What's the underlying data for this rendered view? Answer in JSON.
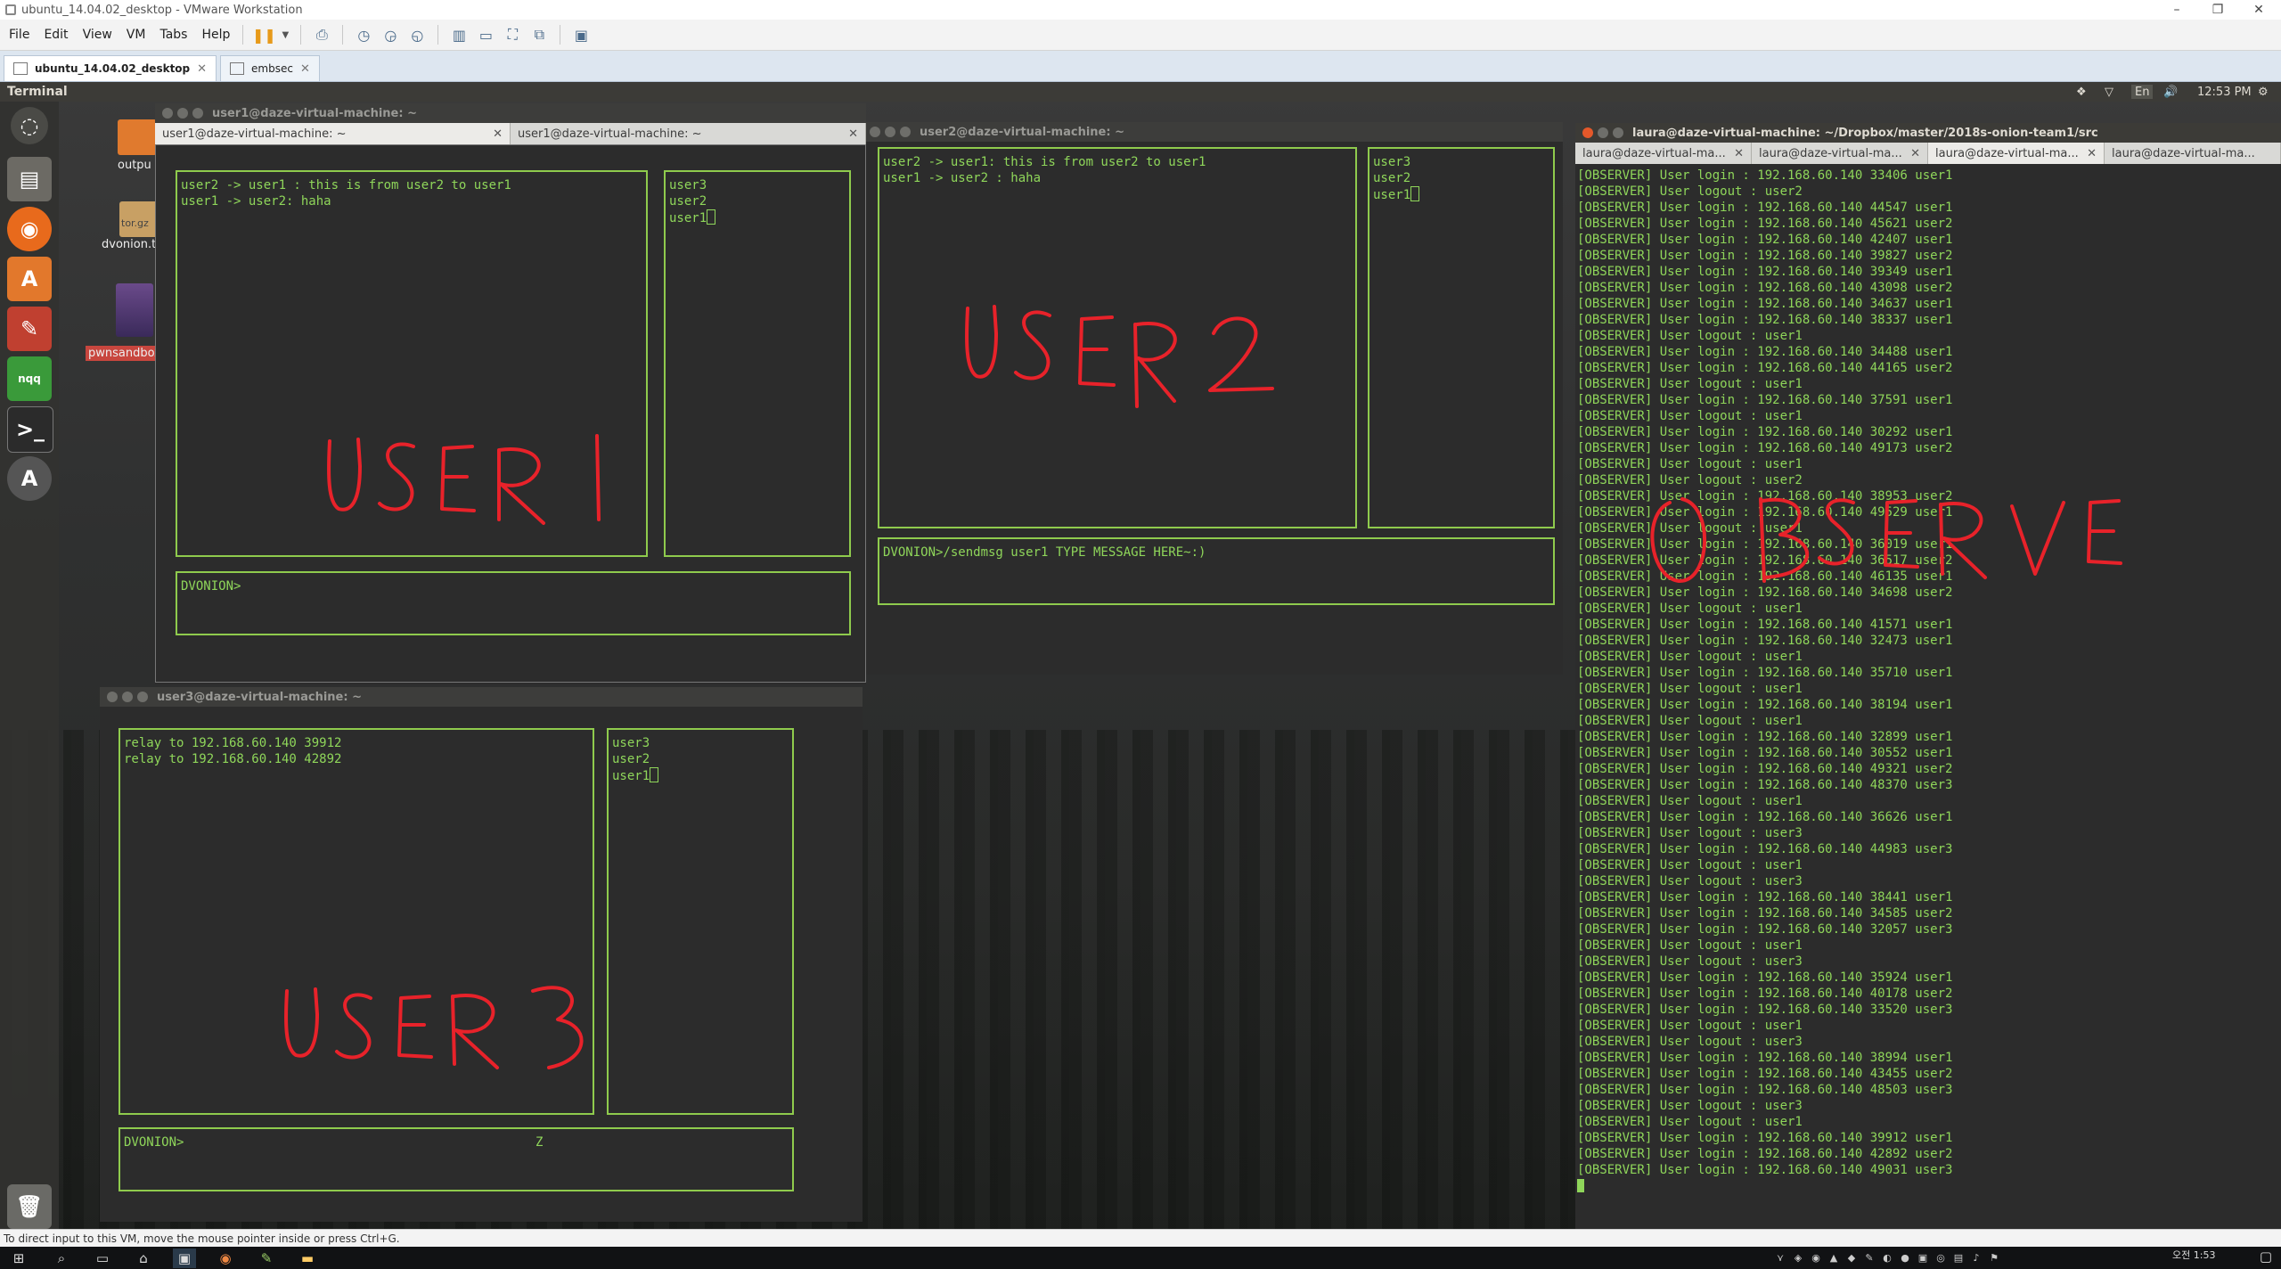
{
  "app": {
    "window_title": "ubuntu_14.04.02_desktop - VMware Workstation",
    "menu": [
      "File",
      "Edit",
      "View",
      "VM",
      "Tabs",
      "Help"
    ],
    "tabs": [
      {
        "label": "ubuntu_14.04.02_desktop",
        "active": true
      },
      {
        "label": "embsec",
        "active": false
      }
    ],
    "status_text": "To direct input to this VM, move the mouse pointer inside or press Ctrl+G."
  },
  "guest": {
    "topbar_title": "Terminal",
    "clock": "12:53 PM",
    "keyboard_layout": "En",
    "desktop_icons": [
      {
        "label": "outpu",
        "color": "#e07a2e"
      },
      {
        "label": "tor.gz",
        "color": "#c8a064"
      },
      {
        "label": "dvonion.tgz",
        "color": ""
      },
      {
        "label": "pwnsandbox.ova",
        "color": "#c8463e"
      }
    ],
    "launcher_icons": [
      "dash-icon",
      "files-icon",
      "firefox-icon",
      "software-center-icon",
      "settings-icon",
      "nqq-icon",
      "terminal-icon",
      "updater-icon",
      "trash-icon"
    ]
  },
  "win_user1": {
    "title": "user1@daze-virtual-machine: ~",
    "tabs": [
      "user1@daze-virtual-machine: ~",
      "user1@daze-virtual-machine: ~"
    ],
    "messages": [
      "user2 -> user1 : this is from user2 to user1",
      "user1 -> user2: haha"
    ],
    "users": [
      "user3",
      "user2",
      "user1"
    ],
    "prompt": "DVONION>",
    "annotation": "USER1"
  },
  "win_user2": {
    "title": "user2@daze-virtual-machine: ~",
    "messages": [
      "user2 -> user1: this is from user2 to user1",
      "user1 -> user2 : haha"
    ],
    "users": [
      "user3",
      "user2",
      "user1"
    ],
    "prompt": "DVONION>/sendmsg user1 TYPE MESSAGE HERE~:)",
    "annotation": "USER2"
  },
  "win_user3": {
    "title": "user3@daze-virtual-machine: ~",
    "messages": [
      "relay to 192.168.60.140 39912",
      "relay to 192.168.60.140 42892"
    ],
    "users": [
      "user3",
      "user2",
      "user1"
    ],
    "prompt": "DVONION>",
    "prompt_extra": "Z",
    "annotation": "USER3"
  },
  "win_observer": {
    "title": "laura@daze-virtual-machine: ~/Dropbox/master/2018s-onion-team1/src",
    "tabs": [
      "laura@daze-virtual-ma...",
      "laura@daze-virtual-ma...",
      "laura@daze-virtual-ma...",
      "laura@daze-virtual-ma..."
    ],
    "annotation": "OBSERVE",
    "lines": [
      "[OBSERVER] User login : 192.168.60.140 33406 user1",
      "[OBSERVER] User logout : user2",
      "[OBSERVER] User login : 192.168.60.140 44547 user1",
      "[OBSERVER] User login : 192.168.60.140 45621 user2",
      "[OBSERVER] User login : 192.168.60.140 42407 user1",
      "[OBSERVER] User login : 192.168.60.140 39827 user2",
      "[OBSERVER] User login : 192.168.60.140 39349 user1",
      "[OBSERVER] User login : 192.168.60.140 43098 user2",
      "[OBSERVER] User login : 192.168.60.140 34637 user1",
      "[OBSERVER] User login : 192.168.60.140 38337 user1",
      "[OBSERVER] User logout : user1",
      "[OBSERVER] User login : 192.168.60.140 34488 user1",
      "[OBSERVER] User login : 192.168.60.140 44165 user2",
      "[OBSERVER] User logout : user1",
      "[OBSERVER] User login : 192.168.60.140 37591 user1",
      "[OBSERVER] User logout : user1",
      "[OBSERVER] User login : 192.168.60.140 30292 user1",
      "[OBSERVER] User login : 192.168.60.140 49173 user2",
      "[OBSERVER] User logout : user1",
      "[OBSERVER] User logout : user2",
      "[OBSERVER] User login : 192.168.60.140 38953 user2",
      "[OBSERVER] User login : 192.168.60.140 49529 user1",
      "[OBSERVER] User logout : user1",
      "[OBSERVER] User login : 192.168.60.140 36019 user1",
      "[OBSERVER] User login : 192.168.60.140 36517 user2",
      "[OBSERVER] User login : 192.168.60.140 46135 user1",
      "[OBSERVER] User login : 192.168.60.140 34698 user2",
      "[OBSERVER] User logout : user1",
      "[OBSERVER] User login : 192.168.60.140 41571 user1",
      "[OBSERVER] User login : 192.168.60.140 32473 user1",
      "[OBSERVER] User logout : user1",
      "[OBSERVER] User login : 192.168.60.140 35710 user1",
      "[OBSERVER] User logout : user1",
      "[OBSERVER] User login : 192.168.60.140 38194 user1",
      "[OBSERVER] User logout : user1",
      "[OBSERVER] User login : 192.168.60.140 32899 user1",
      "[OBSERVER] User login : 192.168.60.140 30552 user1",
      "[OBSERVER] User login : 192.168.60.140 49321 user2",
      "[OBSERVER] User login : 192.168.60.140 48370 user3",
      "[OBSERVER] User logout : user1",
      "[OBSERVER] User login : 192.168.60.140 36626 user1",
      "[OBSERVER] User logout : user3",
      "[OBSERVER] User login : 192.168.60.140 44983 user3",
      "[OBSERVER] User logout : user1",
      "[OBSERVER] User logout : user3",
      "[OBSERVER] User login : 192.168.60.140 38441 user1",
      "[OBSERVER] User login : 192.168.60.140 34585 user2",
      "[OBSERVER] User login : 192.168.60.140 32057 user3",
      "[OBSERVER] User logout : user1",
      "[OBSERVER] User logout : user3",
      "[OBSERVER] User login : 192.168.60.140 35924 user1",
      "[OBSERVER] User login : 192.168.60.140 40178 user2",
      "[OBSERVER] User login : 192.168.60.140 33520 user3",
      "[OBSERVER] User logout : user1",
      "[OBSERVER] User logout : user3",
      "[OBSERVER] User login : 192.168.60.140 38994 user1",
      "[OBSERVER] User login : 192.168.60.140 43455 user2",
      "[OBSERVER] User login : 192.168.60.140 48503 user3",
      "[OBSERVER] User logout : user3",
      "[OBSERVER] User logout : user1",
      "[OBSERVER] User login : 192.168.60.140 39912 user1",
      "[OBSERVER] User login : 192.168.60.140 42892 user2",
      "[OBSERVER] User login : 192.168.60.140 49031 user3"
    ]
  },
  "taskbar": {
    "clock_top": "오전 1:53"
  },
  "colors": {
    "terminal_text": "#8fd65a",
    "box_border": "#8fcb4d",
    "annotation": "#e8222a",
    "terminal_bg": "#2c2c2c"
  }
}
